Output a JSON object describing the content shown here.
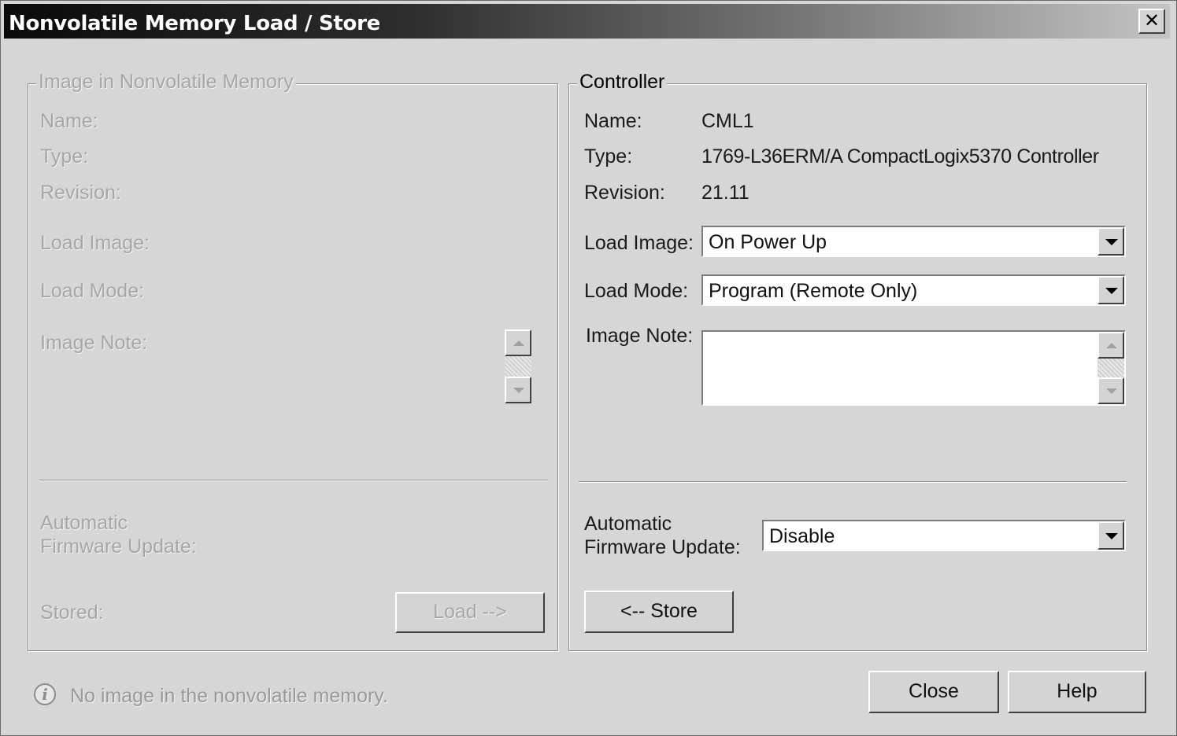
{
  "window": {
    "title": "Nonvolatile Memory Load / Store",
    "close_glyph": "✕"
  },
  "image_group": {
    "legend": "Image in Nonvolatile Memory",
    "name_label": "Name:",
    "type_label": "Type:",
    "revision_label": "Revision:",
    "load_image_label": "Load Image:",
    "load_mode_label": "Load Mode:",
    "image_note_label": "Image Note:",
    "fw_update_label_line1": "Automatic",
    "fw_update_label_line2": "Firmware Update:",
    "stored_label": "Stored:",
    "load_button": "Load -->"
  },
  "controller_group": {
    "legend": "Controller",
    "name_label": "Name:",
    "name_value": "CML1",
    "type_label": "Type:",
    "type_value": "1769-L36ERM/A CompactLogix5370 Controller",
    "revision_label": "Revision:",
    "revision_value": "21.11",
    "load_image_label": "Load Image:",
    "load_image_value": "On Power Up",
    "load_mode_label": "Load Mode:",
    "load_mode_value": "Program (Remote Only)",
    "image_note_label": "Image Note:",
    "image_note_value": "",
    "fw_update_label_line1": "Automatic",
    "fw_update_label_line2": "Firmware Update:",
    "fw_update_value": "Disable",
    "store_button": "<-- Store"
  },
  "footer": {
    "status_icon": "info-icon",
    "status_icon_glyph": "i",
    "status_text": "No image in the nonvolatile memory.",
    "close_button": "Close",
    "help_button": "Help"
  }
}
